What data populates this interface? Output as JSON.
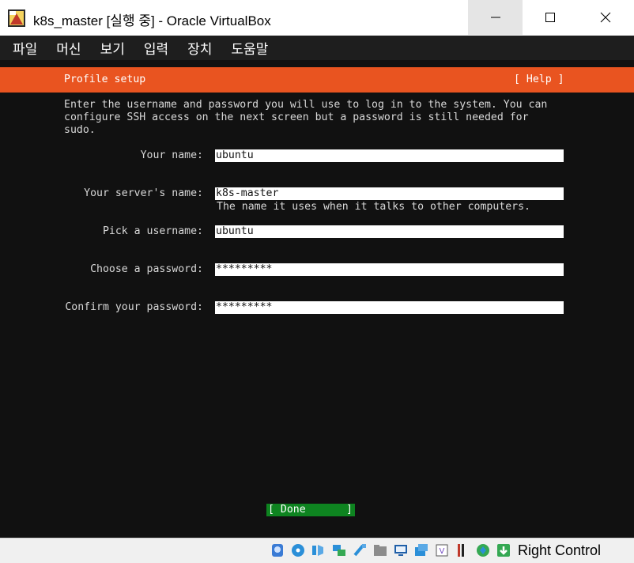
{
  "window": {
    "title": "k8s_master [실행 중] - Oracle VirtualBox"
  },
  "menu": [
    "파일",
    "머신",
    "보기",
    "입력",
    "장치",
    "도움말"
  ],
  "installer": {
    "header_title": "Profile setup",
    "help_label": "[ Help ]",
    "intro": "Enter the username and password you will use to log in to the system. You can\nconfigure SSH access on the next screen but a password is still needed for\nsudo.",
    "fields": [
      {
        "label": "Your name:",
        "value": "ubuntu"
      },
      {
        "label": "Your server's name:",
        "value": "k8s-master",
        "hint": "The name it uses when it talks to other computers."
      },
      {
        "label": "Pick a username:",
        "value": "ubuntu"
      },
      {
        "label": "Choose a password:",
        "value": "*********"
      },
      {
        "label": "Confirm your password:",
        "value": "*********"
      }
    ],
    "done_left": "[ Done",
    "done_right": "]"
  },
  "statusbar": {
    "icons": [
      "hard-disk-icon",
      "optical-drive-icon",
      "audio-icon",
      "network-icon",
      "usb-icon",
      "shared-folder-icon",
      "display-icon",
      "video-capture-icon",
      "cpu-icon",
      "vt-x-icon",
      "mouse-integration-icon",
      "keyboard-capture-icon"
    ],
    "host_key": "Right Control"
  },
  "colors": {
    "header_orange": "#e95420",
    "done_green": "#0e8420",
    "terminal_bg": "#111111",
    "menubar_bg": "#1e1e1e"
  }
}
